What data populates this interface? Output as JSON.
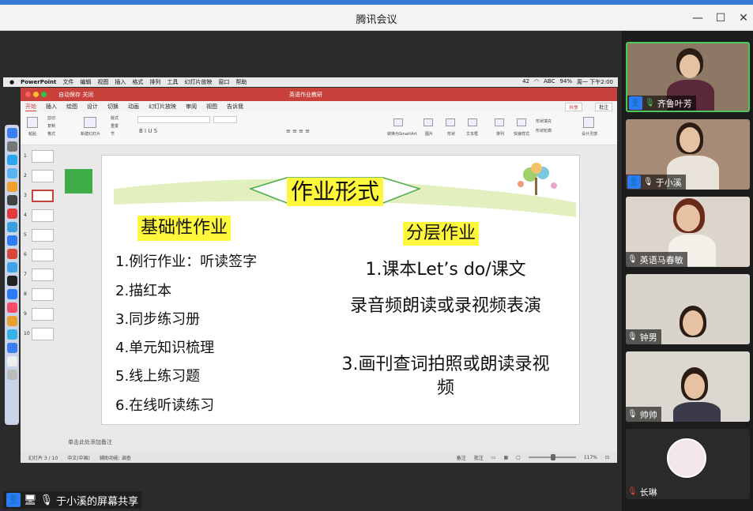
{
  "window": {
    "title": "腾讯会议"
  },
  "mac_menubar": {
    "app": "PowerPoint",
    "menus": [
      "文件",
      "编辑",
      "视图",
      "插入",
      "格式",
      "排列",
      "工具",
      "幻灯片放映",
      "窗口",
      "帮助"
    ],
    "status": [
      "42",
      "ABC",
      "94%",
      "周一 下午2:00"
    ]
  },
  "ppt": {
    "autosave": "自动保存",
    "autosave_state": "关闭",
    "doc_title": "英语作业教研",
    "tabs": [
      "开始",
      "插入",
      "绘图",
      "设计",
      "切换",
      "动画",
      "幻灯片放映",
      "审阅",
      "视图",
      "告诉我"
    ],
    "active_tab": "开始",
    "share_label": "共享",
    "comment_label": "批注",
    "ribbon_labels": {
      "paste": "粘贴",
      "cut": "剪切",
      "copy": "复制",
      "format": "格式",
      "new_slide": "新建幻灯片",
      "layout": "版式",
      "reset": "重置",
      "section": "节",
      "convert_smartart": "转换为SmartArt",
      "picture": "图片",
      "shape": "形状",
      "textbox": "文本框",
      "arrange": "排列",
      "quick_styles": "快速样式",
      "shape_fill": "形状填充",
      "shape_outline": "形状轮廓",
      "designer": "设计灵感"
    },
    "slide_numbers": [
      "1",
      "2",
      "3",
      "4",
      "5",
      "6",
      "7",
      "8",
      "9",
      "10"
    ],
    "active_slide": "3",
    "notes_placeholder": "单击此处添加备注",
    "status": {
      "slide_count": "幻灯片 3 / 10",
      "language": "中文(中国)",
      "accessibility": "辅助功能: 调查",
      "notes": "备注",
      "comments": "批注",
      "zoom": "117%"
    }
  },
  "slide": {
    "title": "作业形式",
    "left_heading": "基础性作业",
    "left_items": [
      "1.例行作业：听读签字",
      "2.描红本",
      "3.同步练习册",
      "4.单元知识梳理",
      "5.线上练习题",
      "6.在线听读练习"
    ],
    "right_heading": "分层作业",
    "right_items": [
      "1.课本Let’s do/课文",
      "录音频朗读或录视频表演",
      "3.画刊查词拍照或朗读录视频"
    ]
  },
  "sharer": {
    "label": "于小溪的屏幕共享"
  },
  "participants": [
    {
      "name": "齐鲁叶芳",
      "mic": "on",
      "active": true
    },
    {
      "name": "于小溪",
      "mic": "on",
      "active": false
    },
    {
      "name": "英语马春敏",
      "mic": "off",
      "active": false
    },
    {
      "name": "钟男",
      "mic": "off",
      "active": false
    },
    {
      "name": "帅帅",
      "mic": "off",
      "active": false
    },
    {
      "name": "长琳",
      "mic": "muted",
      "active": false
    }
  ],
  "colors": {
    "ppt_accent": "#c8413b",
    "highlight_yellow": "#fff73b",
    "active_speaker": "#4cc95a",
    "tencent_blue": "#2d7cf6"
  }
}
